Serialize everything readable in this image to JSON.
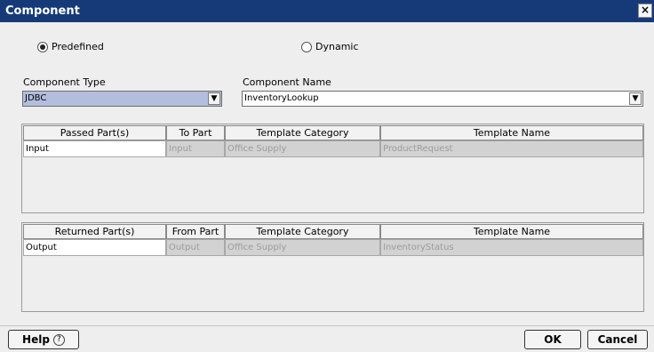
{
  "window": {
    "title": "Component",
    "close_glyph": "×"
  },
  "mode": {
    "predefined_label": "Predefined",
    "dynamic_label": "Dynamic",
    "selected": "Predefined"
  },
  "component_type": {
    "label": "Component Type",
    "value": "JDBC"
  },
  "component_name": {
    "label": "Component Name",
    "value": "InventoryLookup"
  },
  "passed_table": {
    "headers": [
      "Passed Part(s)",
      "To Part",
      "Template Category",
      "Template Name"
    ],
    "rows": [
      [
        "Input",
        "Input",
        "Office Supply",
        "ProductRequest"
      ]
    ]
  },
  "returned_table": {
    "headers": [
      "Returned Part(s)",
      "From Part",
      "Template Category",
      "Template Name"
    ],
    "rows": [
      [
        "Output",
        "Output",
        "Office Supply",
        "InventoryStatus"
      ]
    ]
  },
  "buttons": {
    "help": "Help",
    "ok": "OK",
    "cancel": "Cancel"
  },
  "icons": {
    "help": "question-circle-icon",
    "dropdown": "chevron-down-icon"
  },
  "colors": {
    "titlebar": "#163a78",
    "selected_field": "#b3bede",
    "readonly_cell": "#d2d2d2"
  }
}
